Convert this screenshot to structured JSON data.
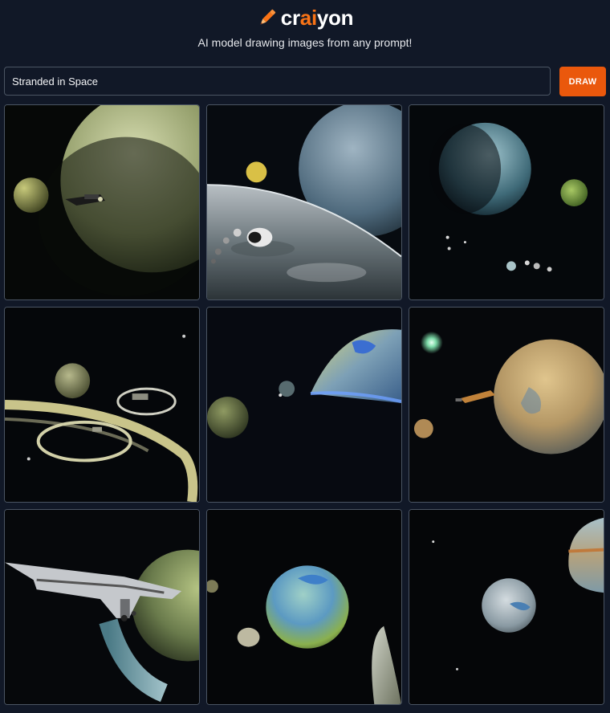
{
  "app": {
    "brand_prefix": "cr",
    "brand_accent": "ai",
    "brand_suffix": "yon",
    "tagline": "AI model drawing images from any prompt!",
    "accent_color": "#f97316"
  },
  "prompt": {
    "value": "Stranded in Space"
  },
  "actions": {
    "draw_label": "DRAW"
  },
  "results": {
    "images": [
      {
        "id": "image-1",
        "subject": "pale planet with spaceship and small moon"
      },
      {
        "id": "image-2",
        "subject": "blue planet over cratered moon surface with capsule"
      },
      {
        "id": "image-3",
        "subject": "blue planet with green moon and drifting debris"
      },
      {
        "id": "image-4",
        "subject": "planet with circular station rings"
      },
      {
        "id": "image-5",
        "subject": "earth-like planet horizon with small moons"
      },
      {
        "id": "image-6",
        "subject": "tan planet with spaceship and bright star"
      },
      {
        "id": "image-7",
        "subject": "large spaceship passing green planet"
      },
      {
        "id": "image-8",
        "subject": "green-blue planet with moonlet and crescent"
      },
      {
        "id": "image-9",
        "subject": "grey moon with gas giant edge"
      }
    ]
  }
}
